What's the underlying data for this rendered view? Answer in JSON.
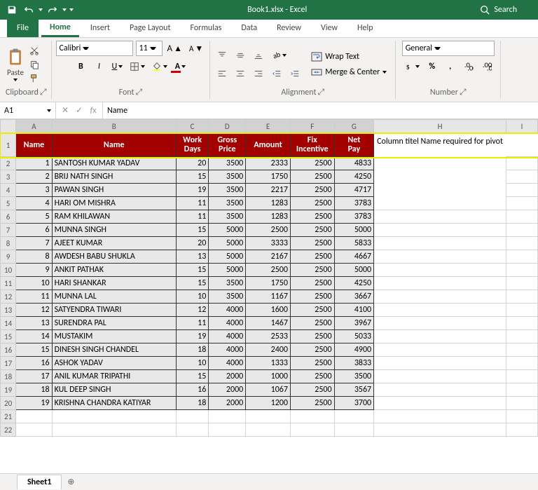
{
  "title": "Book1.xlsx - Excel",
  "search_placeholder": "Search",
  "tabs": {
    "file": "File",
    "home": "Home",
    "insert": "Insert",
    "page_layout": "Page Layout",
    "formulas": "Formulas",
    "data": "Data",
    "review": "Review",
    "view": "View",
    "help": "Help"
  },
  "ribbon": {
    "paste": "Paste",
    "clipboard_label": "Clipboard",
    "font_name": "Calibri",
    "font_size": "11",
    "font_label": "Font",
    "wrap_text": "Wrap Text",
    "merge_center": "Merge & Center",
    "alignment_label": "Alignment",
    "number_format": "General",
    "number_label": "Number"
  },
  "namebox": "A1",
  "formula_value": "Name",
  "grid": {
    "cols": [
      "A",
      "B",
      "C",
      "D",
      "E",
      "F",
      "G",
      "H",
      "I"
    ],
    "headers": [
      "Name",
      "Name",
      "Work Days",
      "Gross Price",
      "Amount",
      "Fix Incentive",
      "Net Pay"
    ],
    "annotation": "Column titel Name required for pivot",
    "rows": [
      [
        1,
        "SANTOSH KUMAR YADAV",
        20,
        3500,
        2333,
        2500,
        4833
      ],
      [
        2,
        "BRIJ NATH SINGH",
        15,
        3500,
        1750,
        2500,
        4250
      ],
      [
        3,
        "PAWAN SINGH",
        19,
        3500,
        2217,
        2500,
        4717
      ],
      [
        4,
        "HARI OM MISHRA",
        11,
        3500,
        1283,
        2500,
        3783
      ],
      [
        5,
        "RAM KHILAWAN",
        11,
        3500,
        1283,
        2500,
        3783
      ],
      [
        6,
        "MUNNA SINGH",
        15,
        5000,
        2500,
        2500,
        5000
      ],
      [
        7,
        "AJEET KUMAR",
        20,
        5000,
        3333,
        2500,
        5833
      ],
      [
        8,
        "AWDESH BABU SHUKLA",
        13,
        5000,
        2167,
        2500,
        4667
      ],
      [
        9,
        "ANKIT PATHAK",
        15,
        5000,
        2500,
        2500,
        5000
      ],
      [
        10,
        "HARI SHANKAR",
        15,
        3500,
        1750,
        2500,
        4250
      ],
      [
        11,
        "MUNNA LAL",
        10,
        3500,
        1167,
        2500,
        3667
      ],
      [
        12,
        "SATYENDRA TIWARI",
        12,
        4000,
        1600,
        2500,
        4100
      ],
      [
        13,
        "SURENDRA PAL",
        11,
        4000,
        1467,
        2500,
        3967
      ],
      [
        14,
        "MUSTAKIM",
        19,
        4000,
        2533,
        2500,
        5033
      ],
      [
        15,
        "DINESH SINGH CHANDEL",
        18,
        4000,
        2400,
        2500,
        4900
      ],
      [
        16,
        "ASHOK YADAV",
        10,
        4000,
        1333,
        2500,
        3833
      ],
      [
        17,
        "ANIL KUMAR TRIPATHI",
        15,
        2000,
        1000,
        2500,
        3500
      ],
      [
        18,
        "KUL DEEP SINGH",
        16,
        2000,
        1067,
        2500,
        3567
      ],
      [
        19,
        "KRISHNA CHANDRA KATIYAR",
        18,
        2000,
        1200,
        2500,
        3700
      ]
    ]
  },
  "sheet_tab": "Sheet1"
}
